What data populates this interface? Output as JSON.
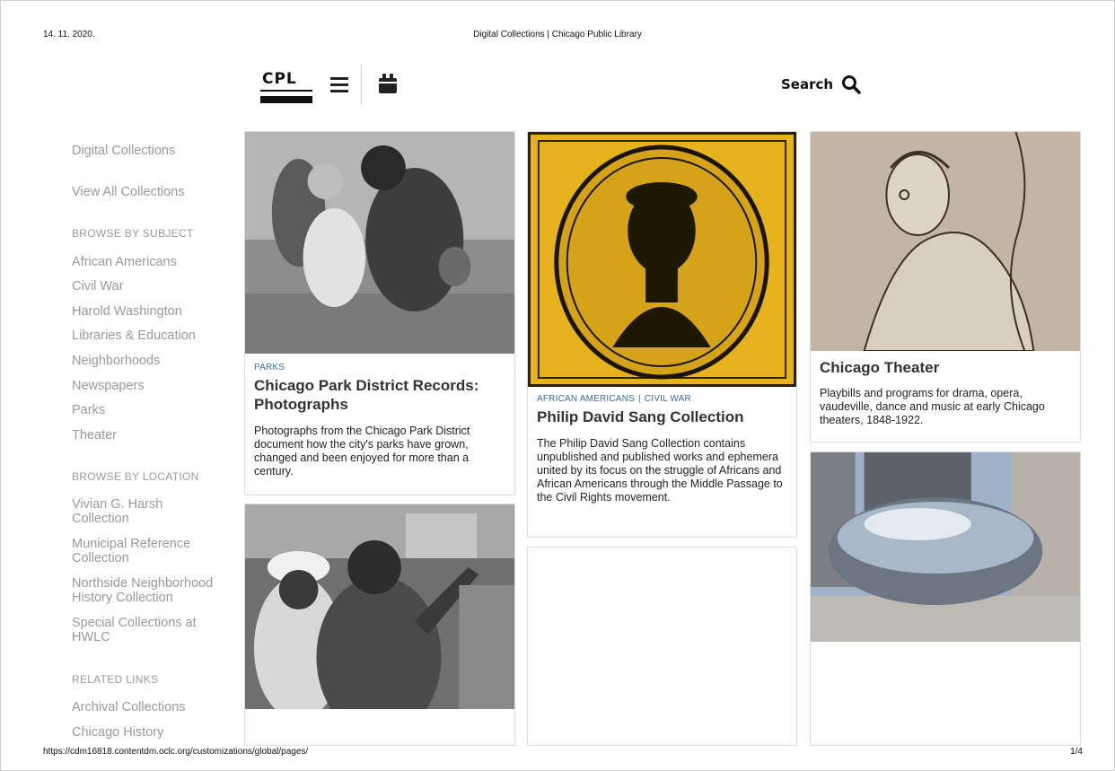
{
  "print": {
    "date": "14. 11. 2020.",
    "title": "Digital Collections | Chicago Public Library",
    "url": "https://cdm16818.contentdm.oclc.org/customizations/global/pages/",
    "page": "1/4"
  },
  "header": {
    "logo_text": "CPL",
    "search_label": "Search"
  },
  "sidebar": {
    "top_links": [
      "Digital Collections",
      "View All Collections"
    ],
    "browse_subject_heading": "BROWSE BY SUBJECT",
    "subjects": [
      "African Americans",
      "Civil War",
      "Harold Washington",
      "Libraries & Education",
      "Neighborhoods",
      "Newspapers",
      "Parks",
      "Theater"
    ],
    "browse_location_heading": "BROWSE BY LOCATION",
    "locations": [
      "Vivian G. Harsh Collection",
      "Municipal Reference Collection",
      "Northside Neighborhood History Collection",
      "Special Collections at HWLC"
    ],
    "related_heading": "RELATED LINKS",
    "related": [
      "Archival Collections",
      "Chicago History"
    ]
  },
  "cards": {
    "parks": {
      "tag": "PARKS",
      "title": "Chicago Park District Records: Photographs",
      "description": "Photographs from the Chicago Park District document how the city's parks have grown, changed and been enjoyed for more than a century."
    },
    "sang": {
      "tag1": "AFRICAN AMERICANS",
      "tag2": "CIVIL WAR",
      "title": "Philip David Sang Collection",
      "description": "The Philip David Sang Collection contains unpublished and published works and ephemera united by its focus on the struggle of Africans and African Americans through the Middle Passage to the Civil Rights movement."
    },
    "theater": {
      "title": "Chicago Theater",
      "description": "Playbills and programs for drama, opera, vaudeville, dance and music at early Chicago theaters, 1848-1922."
    }
  },
  "colors": {
    "tag_link": "#3a6aa8",
    "sidebar_text": "#9a9a9a",
    "sang_image_bg": "#e6b31e"
  }
}
